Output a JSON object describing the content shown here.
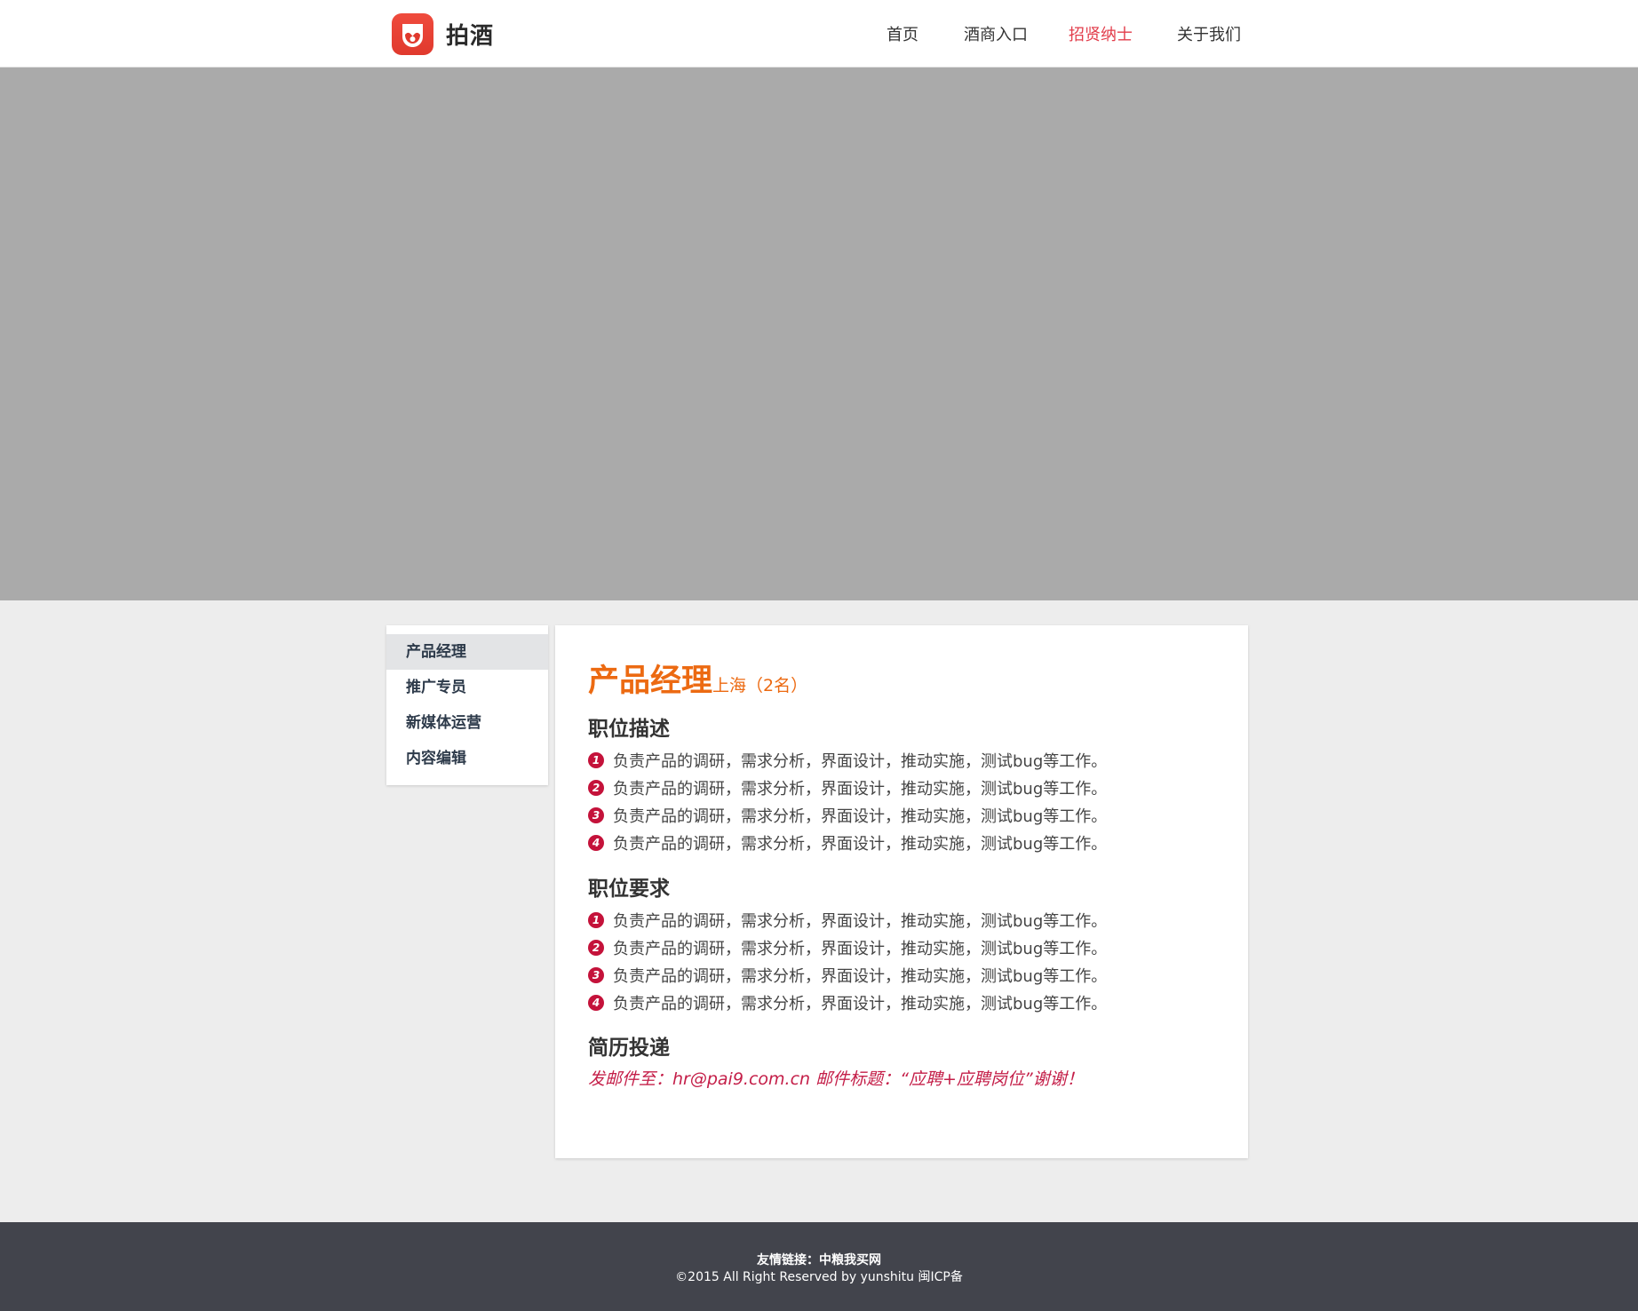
{
  "header": {
    "logo_text": "拍酒",
    "nav": [
      {
        "label": "首页",
        "active": false
      },
      {
        "label": "酒商入口",
        "active": false
      },
      {
        "label": "招贤纳士",
        "active": true
      },
      {
        "label": "关于我们",
        "active": false
      }
    ]
  },
  "sidebar": {
    "items": [
      {
        "label": "产品经理",
        "active": true
      },
      {
        "label": "推广专员",
        "active": false
      },
      {
        "label": "新媒体运营",
        "active": false
      },
      {
        "label": "内容编辑",
        "active": false
      }
    ]
  },
  "job": {
    "title": "产品经理",
    "location": "上海（2名）",
    "description_heading": "职位描述",
    "description": [
      {
        "num": "1",
        "text": "负责产品的调研，需求分析，界面设计，推动实施，测试bug等工作。"
      },
      {
        "num": "2",
        "text": "负责产品的调研，需求分析，界面设计，推动实施，测试bug等工作。"
      },
      {
        "num": "3",
        "text": "负责产品的调研，需求分析，界面设计，推动实施，测试bug等工作。"
      },
      {
        "num": "4",
        "text": "负责产品的调研，需求分析，界面设计，推动实施，测试bug等工作。"
      }
    ],
    "requirements_heading": "职位要求",
    "requirements": [
      {
        "num": "1",
        "text": "负责产品的调研，需求分析，界面设计，推动实施，测试bug等工作。"
      },
      {
        "num": "2",
        "text": "负责产品的调研，需求分析，界面设计，推动实施，测试bug等工作。"
      },
      {
        "num": "3",
        "text": "负责产品的调研，需求分析，界面设计，推动实施，测试bug等工作。"
      },
      {
        "num": "4",
        "text": "负责产品的调研，需求分析，界面设计，推动实施，测试bug等工作。"
      }
    ],
    "resume_heading": "简历投递",
    "resume_text": "发邮件至：hr@pai9.com.cn 邮件标题：“应聘+应聘岗位”谢谢！"
  },
  "footer": {
    "links_label": "友情链接：",
    "link": "中粮我买网",
    "copyright": "©2015 All Right Reserved by yunshitu 闽ICP备"
  },
  "colors": {
    "accent_nav": "#e23d4b",
    "title_orange": "#ec6a12",
    "number_badge": "#c4123a",
    "banner_gray": "#aaaaaa",
    "footer_bg": "#42444c"
  }
}
